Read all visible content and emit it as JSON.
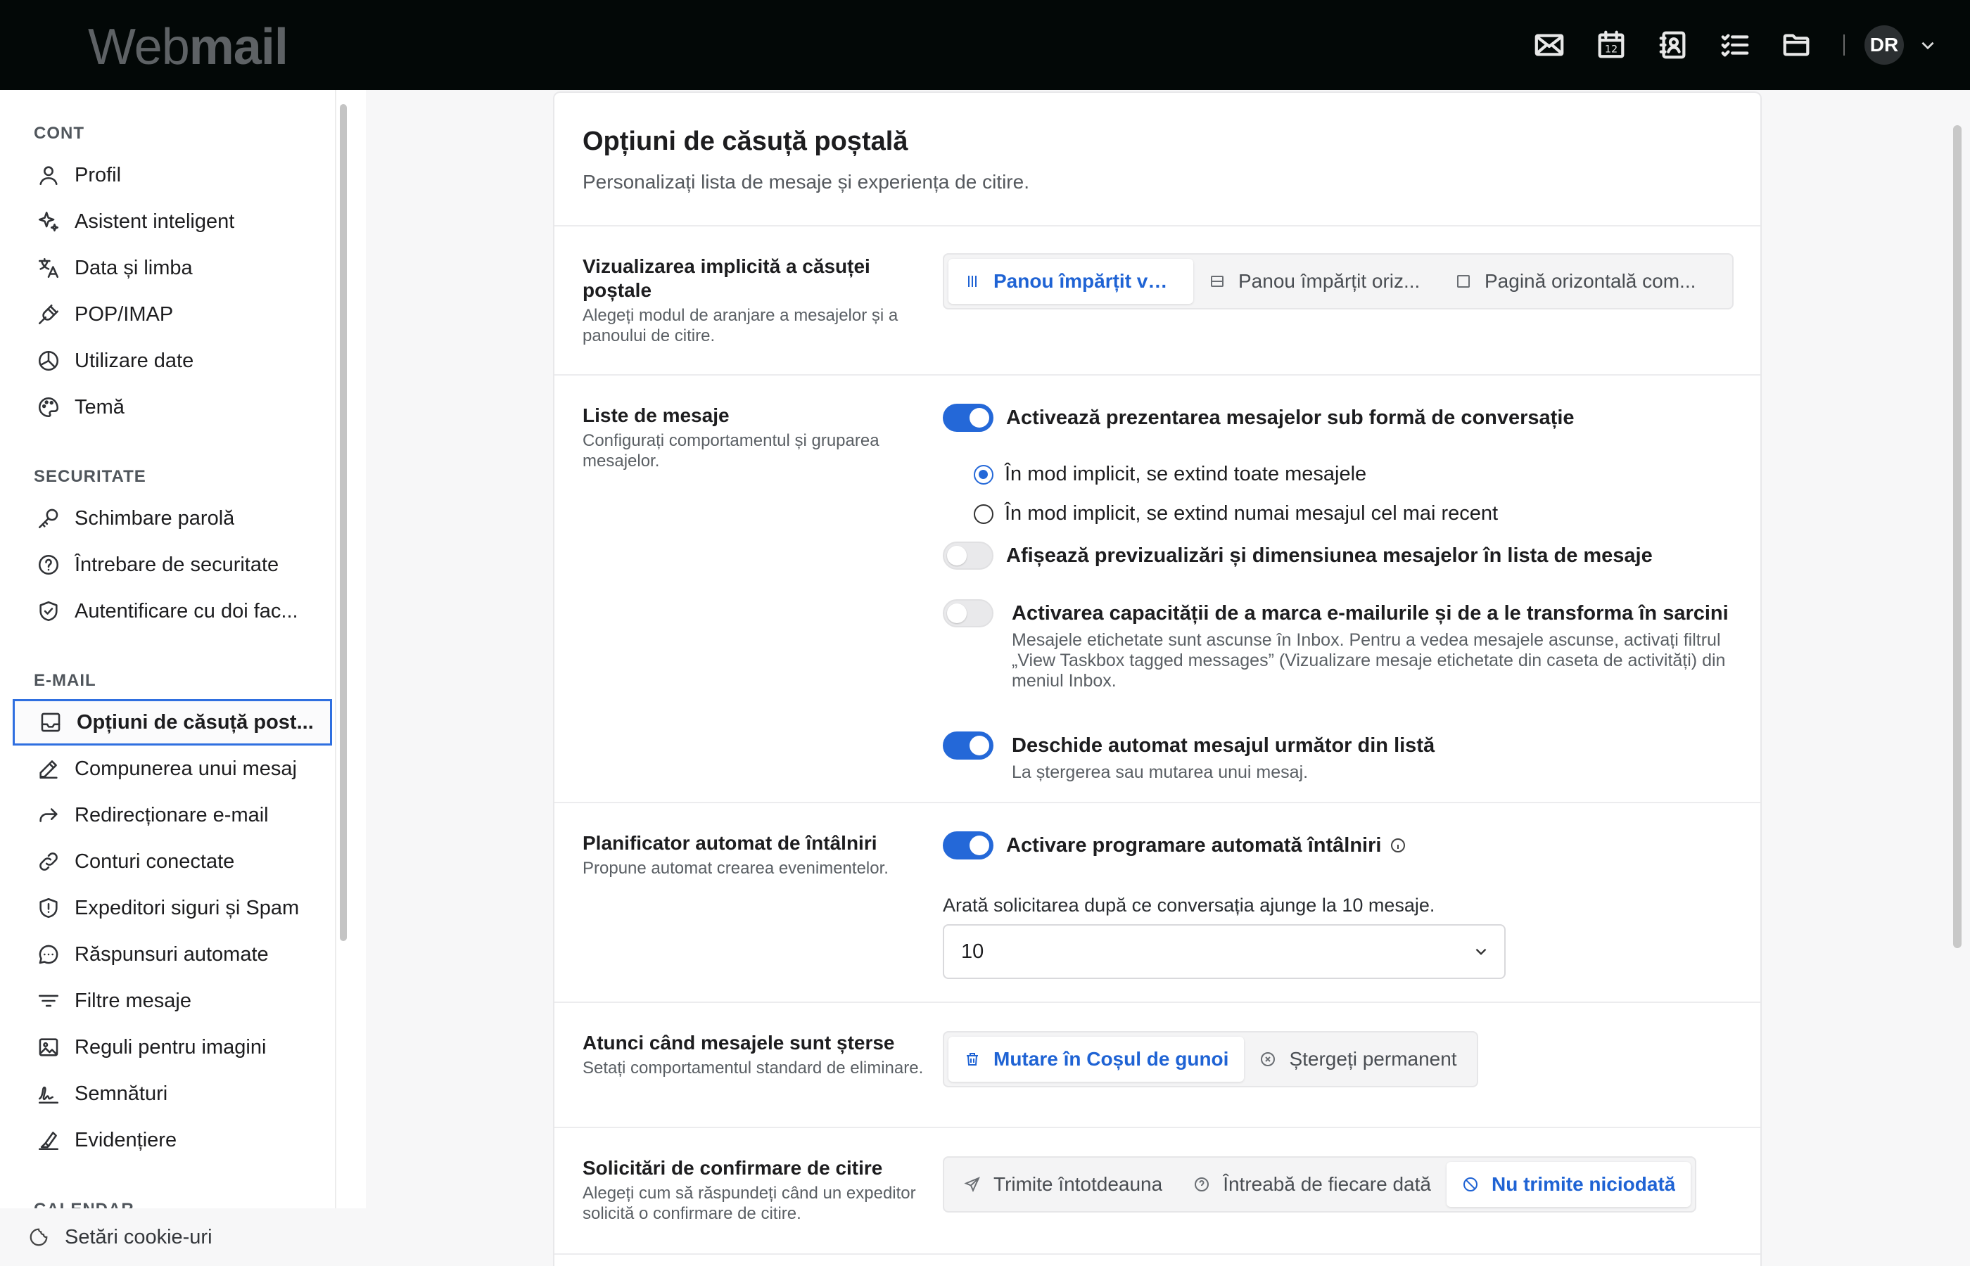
{
  "app": {
    "logo_light": "Web",
    "logo_bold": "mail",
    "avatar_initials": "DR"
  },
  "topbar": {
    "icons": [
      "mail-icon",
      "calendar-icon",
      "contacts-icon",
      "tasks-icon",
      "files-icon"
    ],
    "calendar_day": "12"
  },
  "sidebar": {
    "sections": [
      {
        "title": "CONT",
        "items": [
          {
            "label": "Profil",
            "icon": "user-icon"
          },
          {
            "label": "Asistent inteligent",
            "icon": "sparkle-icon"
          },
          {
            "label": "Data și limba",
            "icon": "translate-icon"
          },
          {
            "label": "POP/IMAP",
            "icon": "plug-icon"
          },
          {
            "label": "Utilizare date",
            "icon": "pie-chart-icon"
          },
          {
            "label": "Temă",
            "icon": "palette-icon"
          }
        ]
      },
      {
        "title": "SECURITATE",
        "items": [
          {
            "label": "Schimbare parolă",
            "icon": "key-icon"
          },
          {
            "label": "Întrebare de securitate",
            "icon": "question-icon"
          },
          {
            "label": "Autentificare cu doi fac...",
            "icon": "shield-check-icon"
          }
        ]
      },
      {
        "title": "E-MAIL",
        "items": [
          {
            "label": "Opțiuni de căsuță post...",
            "icon": "inbox-icon",
            "active": true
          },
          {
            "label": "Compunerea unui mesaj",
            "icon": "pencil-icon"
          },
          {
            "label": "Redirecționare e-mail",
            "icon": "forward-icon"
          },
          {
            "label": "Conturi conectate",
            "icon": "link-icon"
          },
          {
            "label": "Expeditori siguri și Spam",
            "icon": "shield-alert-icon"
          },
          {
            "label": "Răspunsuri automate",
            "icon": "chat-icon"
          },
          {
            "label": "Filtre mesaje",
            "icon": "filter-icon"
          },
          {
            "label": "Reguli pentru imagini",
            "icon": "image-icon"
          },
          {
            "label": "Semnături",
            "icon": "signature-icon"
          },
          {
            "label": "Evidențiere",
            "icon": "highlighter-icon"
          }
        ]
      },
      {
        "title": "CALENDAR",
        "items": []
      }
    ],
    "cookie_label": "Setări cookie-uri"
  },
  "panel": {
    "title": "Opțiuni de căsuță poștală",
    "subtitle": "Personalizați lista de mesaje și experiența de citire.",
    "view": {
      "title": "Vizualizarea implicită a căsuței poștale",
      "desc": "Alegeți modul de aranjare a mesajelor și a panoului de citire.",
      "options": [
        "Panou împărțit ver...",
        "Panou împărțit oriz...",
        "Pagină orizontală com..."
      ],
      "selected": 0
    },
    "lists": {
      "title": "Liste de mesaje",
      "desc": "Configurați comportamentul și gruparea mesajelor.",
      "conversation": {
        "label": "Activează prezentarea mesajelor sub formă de conversație",
        "on": true
      },
      "radio_all": "În mod implicit, se extind toate mesajele",
      "radio_recent": "În mod implicit, se extind numai mesajul cel mai recent",
      "previews": {
        "label": "Afișează previzualizări și dimensiunea mesajelor în lista de mesaje",
        "on": false
      },
      "tasks": {
        "label": "Activarea capacității de a marca e-mailurile și de a le transforma în sarcini",
        "desc": "Mesajele etichetate sunt ascunse în Inbox. Pentru a vedea mesajele ascunse, activați filtrul „View Taskbox tagged messages” (Vizualizare mesaje etichetate din caseta de activități) din meniul Inbox.",
        "on": false
      },
      "autoopen": {
        "label": "Deschide automat mesajul următor din listă",
        "desc": "La ștergerea sau mutarea unui mesaj.",
        "on": true
      }
    },
    "scheduler": {
      "title": "Planificator automat de întâlniri",
      "desc": "Propune automat crearea evenimentelor.",
      "toggle_label": "Activare programare automată întâlniri",
      "on": true,
      "helper": "Arată solicitarea după ce conversația ajunge la 10 mesaje.",
      "select_value": "10"
    },
    "delete": {
      "title": "Atunci când mesajele sunt șterse",
      "desc": "Setați comportamentul standard de eliminare.",
      "options": [
        "Mutare în Coșul de gunoi",
        "Ștergeți permanent"
      ],
      "selected": 0
    },
    "receipts": {
      "title": "Solicitări de confirmare de citire",
      "desc": "Alegeți cum să răspundeți când un expeditor solicită o confirmare de citire.",
      "options": [
        "Trimite întotdeauna",
        "Întreabă de fiecare dată",
        "Nu trimite niciodată"
      ],
      "selected": 2
    }
  },
  "colors": {
    "accent": "#2468d8",
    "topbar": "#030807",
    "selected_text": "#1f63d4"
  }
}
